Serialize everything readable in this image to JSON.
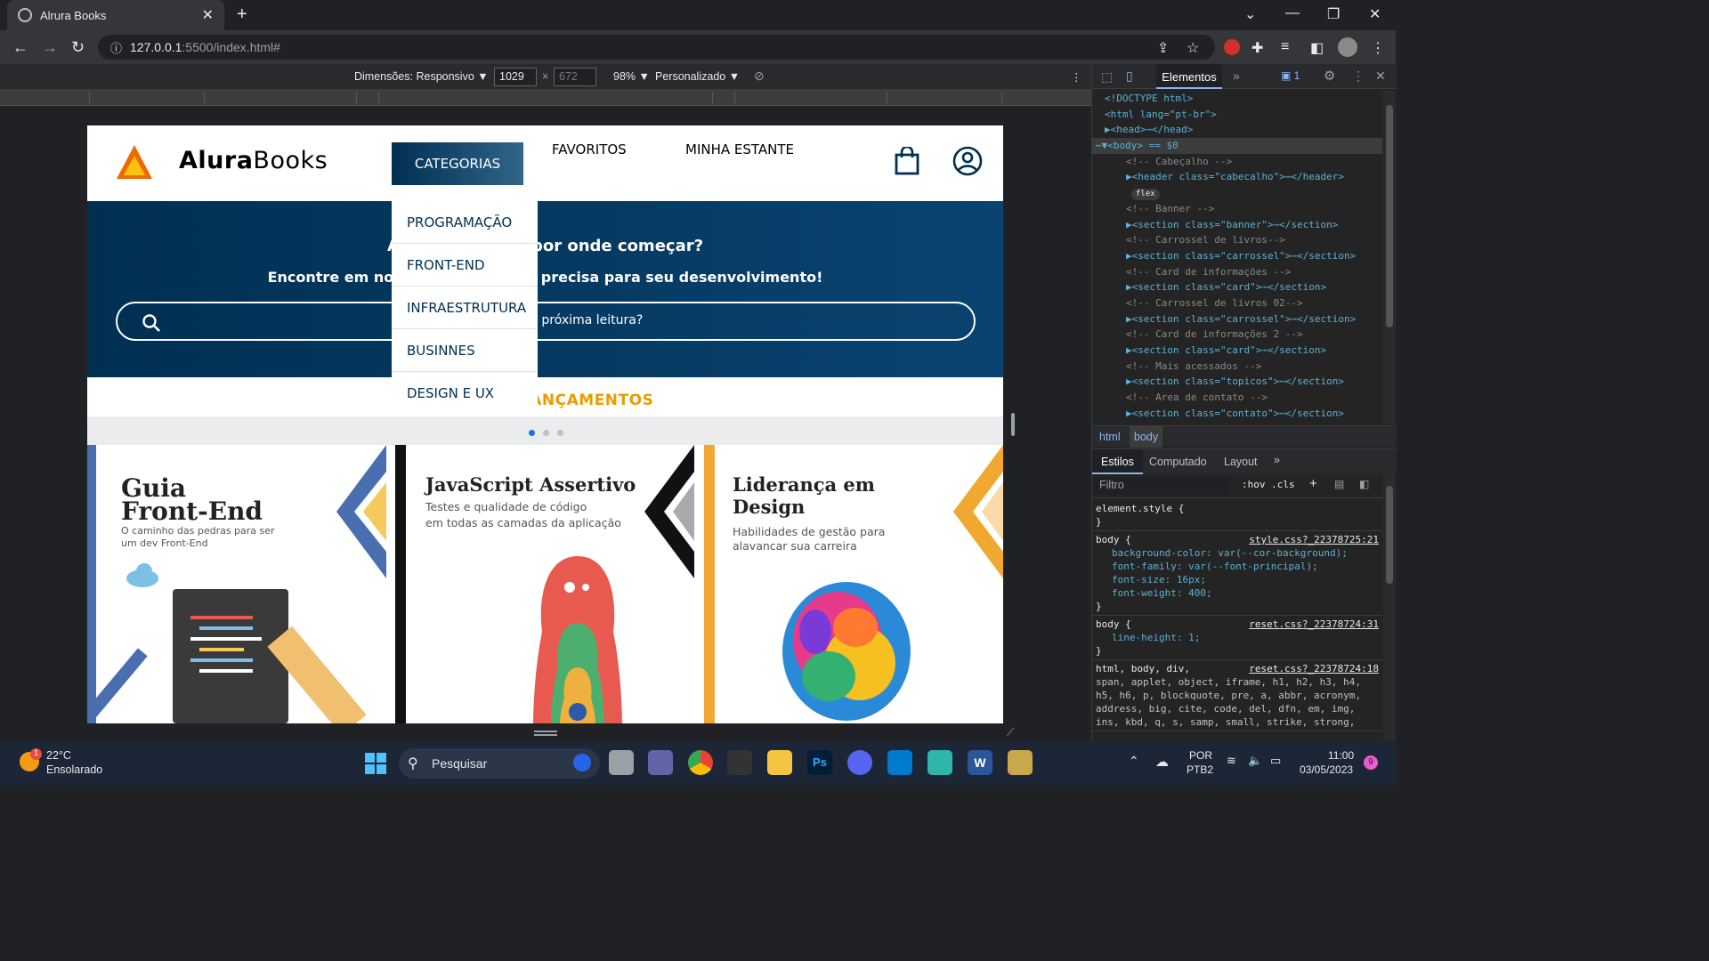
{
  "browser": {
    "tab_title": "Alrura Books",
    "url_host": "127.0.0.1",
    "url_path": ":5500/index.html#"
  },
  "device_toolbar": {
    "dimensions_label": "Dimensões: Responsivo ▼",
    "width": "1029",
    "times": "×",
    "height": "672",
    "zoom": "98% ▼",
    "throttle": "Personalizado ▼"
  },
  "site": {
    "brand_bold": "Alura",
    "brand_rest": "Books",
    "nav": {
      "categorias": "CATEGORIAS",
      "favoritos": "FAVORITOS",
      "estante": "MINHA ESTANTE"
    },
    "dropdown": [
      "PROGRAMAÇÃO",
      "FRONT-END",
      "INFRAESTRUTURA",
      "BUSINNES",
      "DESIGN E UX"
    ],
    "banner": {
      "title": "Ainda não sabe por onde começar?",
      "subtitle": "Encontre em nossa estante o que precisa para seu desenvolvimento!",
      "search_placeholder": "Qual será sua próxima leitura?"
    },
    "section_title": "ÚLTIMOS LANÇAMENTOS",
    "carousel_dots": 3,
    "books": [
      {
        "title_1": "Guia",
        "title_2": "Front-End",
        "subtitle_1": "O caminho das pedras para ser",
        "subtitle_2": "um dev Front-End",
        "accent": "#4a6fb0"
      },
      {
        "title_1": "JavaScript Assertivo",
        "title_2": "",
        "subtitle_1": "Testes e qualidade de código",
        "subtitle_2": "em todas as camadas da aplicação",
        "accent": "#111111"
      },
      {
        "title_1": "Liderança em",
        "title_2": "Design",
        "subtitle_1": "Habilidades de gestão para",
        "subtitle_2": "alavancar sua carreira",
        "accent": "#f0a830"
      }
    ]
  },
  "devtools": {
    "tab_elements": "Elementos",
    "badge": "1",
    "dom": [
      {
        "type": "text",
        "text": "<!DOCTYPE html>"
      },
      {
        "type": "text",
        "text": "<html lang=\"pt-br\">"
      },
      {
        "type": "text",
        "text": "▶<head>⋯</head>"
      },
      {
        "type": "text",
        "text": "⋯▼<body> == $0"
      },
      {
        "type": "comment",
        "text": "<!-- Cabeçalho -->"
      },
      {
        "type": "text",
        "text": "▶<header class=\"cabecalho\">⋯</header>"
      },
      {
        "type": "pill",
        "text": "flex"
      },
      {
        "type": "comment",
        "text": "<!-- Banner -->"
      },
      {
        "type": "text",
        "text": "▶<section class=\"banner\">⋯</section>"
      },
      {
        "type": "comment",
        "text": "<!-- Carrossel de livros-->"
      },
      {
        "type": "text",
        "text": "▶<section class=\"carrossel\">⋯</section>"
      },
      {
        "type": "comment",
        "text": "<!-- Card de informações -->"
      },
      {
        "type": "text",
        "text": "▶<section class=\"card\">⋯</section>"
      },
      {
        "type": "comment",
        "text": "<!-- Carrossel de livros 02-->"
      },
      {
        "type": "text",
        "text": "▶<section class=\"carrossel\">⋯</section>"
      },
      {
        "type": "comment",
        "text": "<!-- Card de informações 2 -->"
      },
      {
        "type": "text",
        "text": "▶<section class=\"card\">⋯</section>"
      },
      {
        "type": "comment",
        "text": "<!-- Mais acessados -->"
      },
      {
        "type": "text",
        "text": "▶<section class=\"topicos\">⋯</section>"
      },
      {
        "type": "comment",
        "text": "<!-- Area de contato -->"
      },
      {
        "type": "text",
        "text": "▶<section class=\"contato\">⋯</section>"
      }
    ],
    "crumbs": [
      "html",
      "body"
    ],
    "subtabs": [
      "Estilos",
      "Computado",
      "Layout"
    ],
    "filter_placeholder": "Filtro",
    "filter_buttons": ":hov .cls",
    "styles": [
      {
        "selector": "element.style {",
        "source": "",
        "props": []
      },
      {
        "selector": "body {",
        "source": "style.css?_22378725:21",
        "props": [
          "background-color: var(--cor-background);",
          "font-family: var(--font-principal);",
          "font-size: 16px;",
          "font-weight: 400;"
        ]
      },
      {
        "selector": "body {",
        "source": "reset.css?_22378724:31",
        "props": [
          "line-height: 1;"
        ]
      },
      {
        "selector": "html, body, div,",
        "source": "reset.css?_22378724:18",
        "props": [
          "span, applet, object, iframe, h1, h2, h3, h4,",
          "h5, h6, p, blockquote, pre, a, abbr, acronym,",
          "address, big, cite, code, del, dfn, em, img,",
          "ins, kbd, q, s, samp, small, strike, strong,"
        ]
      }
    ]
  },
  "taskbar": {
    "weather_temp": "22°C",
    "weather_desc": "Ensolarado",
    "search": "Pesquisar",
    "lang_1": "POR",
    "lang_2": "PTB2",
    "time": "11:00",
    "date": "03/05/2023",
    "notif": "9"
  },
  "colors": {
    "brand_dark": "#002f52",
    "brand_orange": "#eb9b00"
  }
}
